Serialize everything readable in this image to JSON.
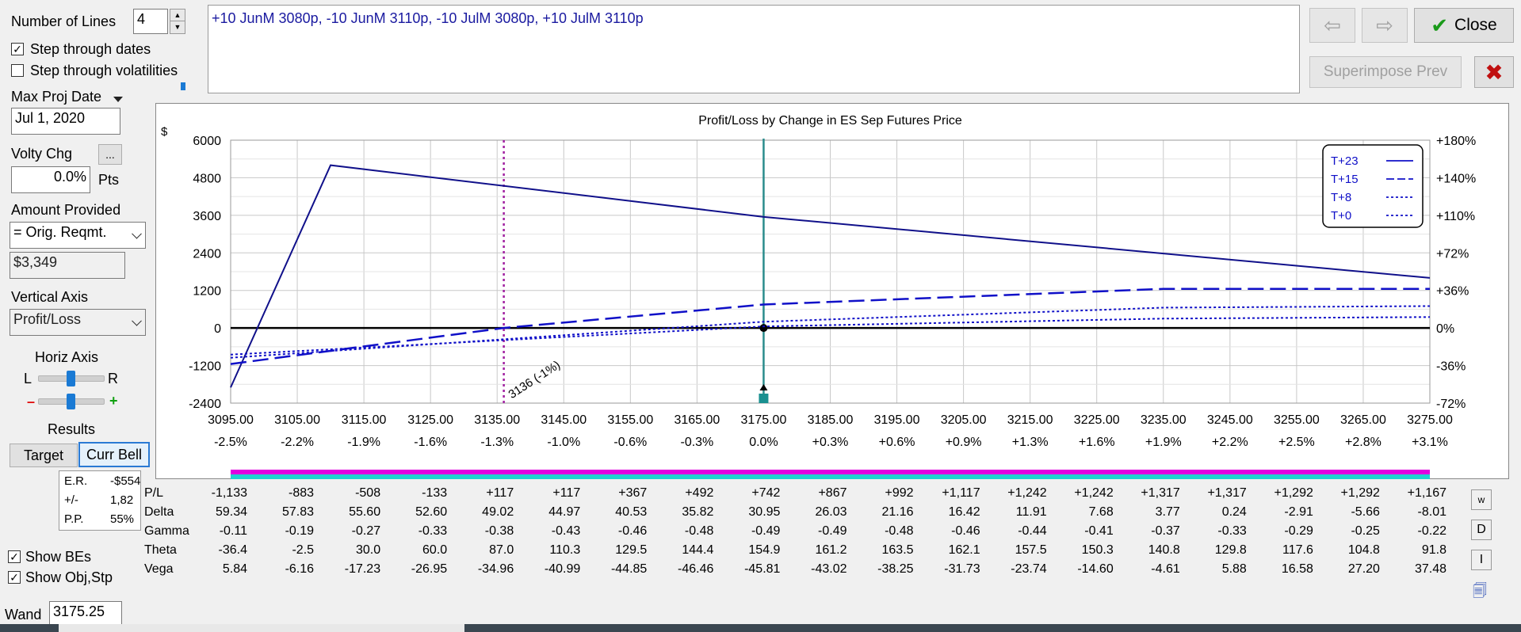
{
  "controls": {
    "num_lines_label": "Number of Lines",
    "num_lines_value": "4",
    "step_dates_label": "Step through dates",
    "step_dates_checked": true,
    "step_vol_label": "Step through volatilities",
    "step_vol_checked": false,
    "max_proj_label": "Max Proj Date",
    "max_proj_value": "Jul 1, 2020",
    "volty_label": "Volty Chg",
    "volty_btn": "...",
    "volty_value": "0.0%",
    "volty_unit": "Pts",
    "amount_label": "Amount Provided",
    "amount_select": "= Orig. Reqmt.",
    "amount_value": "$3,349",
    "vaxis_label": "Vertical Axis",
    "vaxis_select": "Profit/Loss",
    "haxis_label": "Horiz Axis",
    "haxis_l": "L",
    "haxis_r": "R",
    "minus": "–",
    "plus": "+",
    "results_label": "Results",
    "target_btn": "Target",
    "currbell_btn": "Curr Bell",
    "er_label": "E.R.",
    "er_value": "-$554",
    "pm_label": "+/-",
    "pm_value": "1,82",
    "pp_label": "P.P.",
    "pp_value": "55%",
    "show_bes": "Show BEs",
    "show_obj": "Show Obj,Stp",
    "wand_label": "Wand",
    "wand_value": "3175.25"
  },
  "position_text": "+10 JunM 3080p, -10 JunM 3110p, -10 JulM 3080p, +10 JulM 3110p",
  "toolbar": {
    "close_label": "Close",
    "superimpose_label": "Superimpose Prev",
    "prev_arrow": "⇦",
    "next_arrow": "⇨"
  },
  "side_buttons": [
    "w",
    "D",
    "I"
  ],
  "colors": {
    "series": "#1010c8",
    "zero_line": "#000000",
    "current_line": "#2a8c8c",
    "be_line": "#a020a0",
    "bar_magenta": "#e000e0",
    "bar_cyan": "#20d0d0"
  },
  "chart_data": {
    "type": "line",
    "title": "Profit/Loss by Change in ES Sep Futures Price",
    "ylabel": "$",
    "xlim": [
      3095,
      3275
    ],
    "ylim": [
      -2400,
      6000
    ],
    "y_ticks": [
      6000,
      4800,
      3600,
      2400,
      1200,
      0,
      -1200,
      -2400
    ],
    "y2_ticks": [
      "+180%",
      "+140%",
      "+110%",
      "+72%",
      "+36%",
      "0%",
      "-36%",
      "-72%"
    ],
    "x_ticks": [
      "3095.00",
      "3105.00",
      "3115.00",
      "3125.00",
      "3135.00",
      "3145.00",
      "3155.00",
      "3165.00",
      "3175.00",
      "3185.00",
      "3195.00",
      "3205.00",
      "3215.00",
      "3225.00",
      "3235.00",
      "3245.00",
      "3255.00",
      "3265.00",
      "3275.00"
    ],
    "x_pct_ticks": [
      "-2.5%",
      "-2.2%",
      "-1.9%",
      "-1.6%",
      "-1.3%",
      "-1.0%",
      "-0.6%",
      "-0.3%",
      "0.0%",
      "+0.3%",
      "+0.6%",
      "+0.9%",
      "+1.3%",
      "+1.6%",
      "+1.9%",
      "+2.2%",
      "+2.5%",
      "+2.8%",
      "+3.1%"
    ],
    "current_price": 3175,
    "breakeven": 3136,
    "breakeven_label": "3136 (-1%)",
    "grid": true,
    "legend_position": "top-right",
    "series": [
      {
        "name": "T+23",
        "style": "solid",
        "x": [
          3095,
          3110,
          3175,
          3275
        ],
        "y": [
          -1900,
          5200,
          3550,
          1600
        ]
      },
      {
        "name": "T+15",
        "style": "longdash",
        "x": [
          3095,
          3136,
          3175,
          3235,
          3275
        ],
        "y": [
          -1150,
          0,
          750,
          1250,
          1250
        ]
      },
      {
        "name": "T+8",
        "style": "dotted",
        "x": [
          3095,
          3175,
          3235,
          3275
        ],
        "y": [
          -950,
          200,
          650,
          700
        ]
      },
      {
        "name": "T+0",
        "style": "dotted",
        "x": [
          3095,
          3175,
          3235,
          3275
        ],
        "y": [
          -850,
          50,
          300,
          350
        ]
      }
    ]
  },
  "table": {
    "labels": [
      "P/L",
      "Delta",
      "Gamma",
      "Theta",
      "Vega"
    ],
    "rows": [
      [
        "-1,133",
        "-883",
        "-508",
        "-133",
        "+117",
        "+117",
        "+367",
        "+492",
        "+742",
        "+867",
        "+992",
        "+1,117",
        "+1,242",
        "+1,242",
        "+1,317",
        "+1,317",
        "+1,292",
        "+1,292",
        "+1,167"
      ],
      [
        "59.34",
        "57.83",
        "55.60",
        "52.60",
        "49.02",
        "44.97",
        "40.53",
        "35.82",
        "30.95",
        "26.03",
        "21.16",
        "16.42",
        "11.91",
        "7.68",
        "3.77",
        "0.24",
        "-2.91",
        "-5.66",
        "-8.01"
      ],
      [
        "-0.11",
        "-0.19",
        "-0.27",
        "-0.33",
        "-0.38",
        "-0.43",
        "-0.46",
        "-0.48",
        "-0.49",
        "-0.49",
        "-0.48",
        "-0.46",
        "-0.44",
        "-0.41",
        "-0.37",
        "-0.33",
        "-0.29",
        "-0.25",
        "-0.22"
      ],
      [
        "-36.4",
        "-2.5",
        "30.0",
        "60.0",
        "87.0",
        "110.3",
        "129.5",
        "144.4",
        "154.9",
        "161.2",
        "163.5",
        "162.1",
        "157.5",
        "150.3",
        "140.8",
        "129.8",
        "117.6",
        "104.8",
        "91.8"
      ],
      [
        "5.84",
        "-6.16",
        "-17.23",
        "-26.95",
        "-34.96",
        "-40.99",
        "-44.85",
        "-46.46",
        "-45.81",
        "-43.02",
        "-38.25",
        "-31.73",
        "-23.74",
        "-14.60",
        "-4.61",
        "5.88",
        "16.58",
        "27.20",
        "37.48"
      ]
    ]
  }
}
